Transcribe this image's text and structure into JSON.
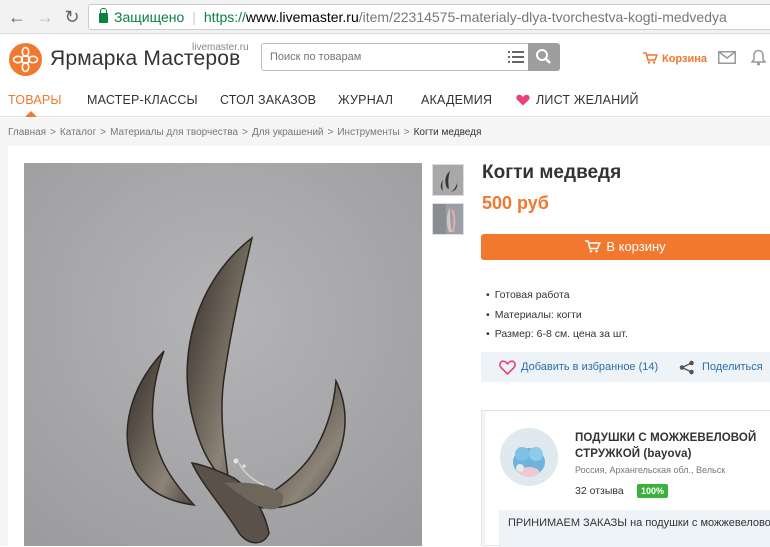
{
  "browser": {
    "secure_label": "Защищено",
    "url_scheme": "https://",
    "url_host": "www.livemaster.ru",
    "url_path": "/item/22314575-materialy-dlya-tvorchestva-kogti-medvedya"
  },
  "header": {
    "logo_text": "Ярмарка Мастеров",
    "logo_domain": "livemaster.ru",
    "search_placeholder": "Поиск по товарам",
    "cart_label": "Корзина"
  },
  "nav": {
    "items": [
      "ТОВАРЫ",
      "МАСТЕР-КЛАССЫ",
      "СТОЛ ЗАКАЗОВ",
      "ЖУРНАЛ",
      "АКАДЕМИЯ"
    ],
    "wishlist": "ЛИСТ ЖЕЛАНИЙ"
  },
  "breadcrumbs": [
    "Главная",
    "Каталог",
    "Материалы для творчества",
    "Для украшений",
    "Инструменты",
    "Когти медведя"
  ],
  "product": {
    "title": "Когти медведя",
    "price": "500 руб",
    "buy_label": "В корзину",
    "facts": [
      "Готовая работа",
      "Материалы:  когти",
      "Размер: 6-8 см. цена за шт."
    ],
    "favorite_label": "Добавить в избранное (14)",
    "share_label": "Поделиться"
  },
  "seller": {
    "name": "ПОДУШКИ С МОЖЖЕВЕЛОВОЙ СТРУЖКОЙ (bayova)",
    "location": "Россия, Архангельская обл., Вельск",
    "reviews": "32 отзыва",
    "rating": "100%",
    "notice": "ПРИНИМАЕМ ЗАКАЗЫ на подушки с можжевеловой стружкой,перья птиц,травы, спилы"
  },
  "colors": {
    "accent": "#f1782c",
    "secure": "#0b8043",
    "link": "#2a6ea6",
    "wishlist": "#e8437c",
    "badge": "#3cb03c"
  }
}
